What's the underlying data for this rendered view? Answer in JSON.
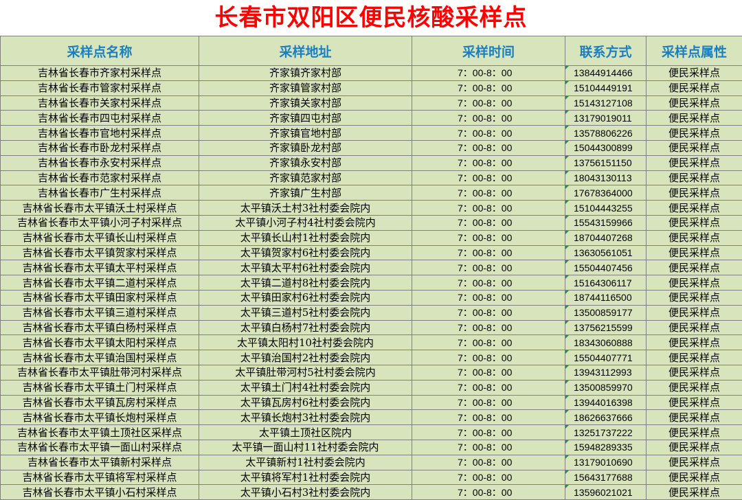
{
  "title": "长春市双阳区便民核酸采样点",
  "headers": [
    "采样点名称",
    "采样地址",
    "采样时间",
    "联系方式",
    "采样点属性"
  ],
  "rows": [
    [
      "吉林省长春市齐家村采样点",
      "齐家镇齐家村部",
      "7：00-8：00",
      "13844914466",
      "便民采样点"
    ],
    [
      "吉林省长春市管家村采样点",
      "齐家镇管家村部",
      "7：00-8：00",
      "15104449191",
      "便民采样点"
    ],
    [
      "吉林省长春市关家村采样点",
      "齐家镇关家村部",
      "7：00-8：00",
      "15143127108",
      "便民采样点"
    ],
    [
      "吉林省长春市四屯村采样点",
      "齐家镇四屯村部",
      "7：00-8：00",
      "13179019011",
      "便民采样点"
    ],
    [
      "吉林省长春市官地村采样点",
      "齐家镇官地村部",
      "7：00-8：00",
      "13578806226",
      "便民采样点"
    ],
    [
      "吉林省长春市卧龙村采样点",
      "齐家镇卧龙村部",
      "7：00-8：00",
      "15044300899",
      "便民采样点"
    ],
    [
      "吉林省长春市永安村采样点",
      "齐家镇永安村部",
      "7：00-8：00",
      "13756151150",
      "便民采样点"
    ],
    [
      "吉林省长春市范家村采样点",
      "齐家镇范家村部",
      "7：00-8：00",
      "18043130113",
      "便民采样点"
    ],
    [
      "吉林省长春市广生村采样点",
      "齐家镇广生村部",
      "7：00-8：00",
      "17678364000",
      "便民采样点"
    ],
    [
      "吉林省长春市太平镇沃土村采样点",
      "太平镇沃土村3社村委会院内",
      "7：00-8：00",
      "15104443255",
      "便民采样点"
    ],
    [
      "吉林省长春市太平镇小河子村采样点",
      "太平镇小河子村4社村委会院内",
      "7：00-8：00",
      "15543159966",
      "便民采样点"
    ],
    [
      "吉林省长春市太平镇长山村采样点",
      "太平镇长山村1社村委会院内",
      "7：00-8：00",
      "18704407268",
      "便民采样点"
    ],
    [
      "吉林省长春市太平镇贺家村采样点",
      "太平镇贺家村6社村委会院内",
      "7：00-8：00",
      "13630561051",
      "便民采样点"
    ],
    [
      "吉林省长春市太平镇太平村采样点",
      "太平镇太平村6社村委会院内",
      "7：00-8：00",
      "15504407456",
      "便民采样点"
    ],
    [
      "吉林省长春市太平镇二道村采样点",
      "太平镇二道村8社村委会院内",
      "7：00-8：00",
      "15164306117",
      "便民采样点"
    ],
    [
      "吉林省长春市太平镇田家村采样点",
      "太平镇田家村6社村委会院内",
      "7：00-8：00",
      "18744116500",
      "便民采样点"
    ],
    [
      "吉林省长春市太平镇三道村采样点",
      "太平镇三道村5社村委会院内",
      "7：00-8：00",
      "13500859177",
      "便民采样点"
    ],
    [
      "吉林省长春市太平镇白杨村采样点",
      "太平镇白杨村7社村委会院内",
      "7：00-8：00",
      "13756215599",
      "便民采样点"
    ],
    [
      "吉林省长春市太平镇太阳村采样点",
      "太平镇太阳村10社村委会院内",
      "7：00-8：00",
      "18343060888",
      "便民采样点"
    ],
    [
      "吉林省长春市太平镇治国村采样点",
      "太平镇治国村2社村委会院内",
      "7：00-8：00",
      "15504407771",
      "便民采样点"
    ],
    [
      "吉林省长春市太平镇肚带河村采样点",
      "太平镇肚带河村5社村委会院内",
      "7：00-8：00",
      "13943112993",
      "便民采样点"
    ],
    [
      "吉林省长春市太平镇土门村采样点",
      "太平镇土门村4社村委会院内",
      "7：00-8：00",
      "13500859970",
      "便民采样点"
    ],
    [
      "吉林省长春市太平镇瓦房村采样点",
      "太平镇瓦房村6社村委会院内",
      "7：00-8：00",
      "13944016398",
      "便民采样点"
    ],
    [
      "吉林省长春市太平镇长炮村采样点",
      "太平镇长炮村3社村委会院内",
      "7：00-8：00",
      "18626637666",
      "便民采样点"
    ],
    [
      "吉林省长春市太平镇土顶社区采样点",
      "太平镇土顶社区院内",
      "7：00-8：00",
      "13251737222",
      "便民采样点"
    ],
    [
      "吉林省长春市太平镇一面山村采样点",
      "太平镇一面山村11社村委会院内",
      "7：00-8：00",
      "15948289335",
      "便民采样点"
    ],
    [
      "吉林省长春市太平镇新村采样点",
      "太平镇新村1社村委会院内",
      "7：00-8：00",
      "13179010690",
      "便民采样点"
    ],
    [
      "吉林省长春市太平镇将军村采样点",
      "太平镇将军村1社村委会院内",
      "7：00-8：00",
      "15643177688",
      "便民采样点"
    ],
    [
      "吉林省长春市太平镇小石村采样点",
      "太平镇小石村3社村委会院内",
      "7：00-8：00",
      "13596021021",
      "便民采样点"
    ]
  ]
}
